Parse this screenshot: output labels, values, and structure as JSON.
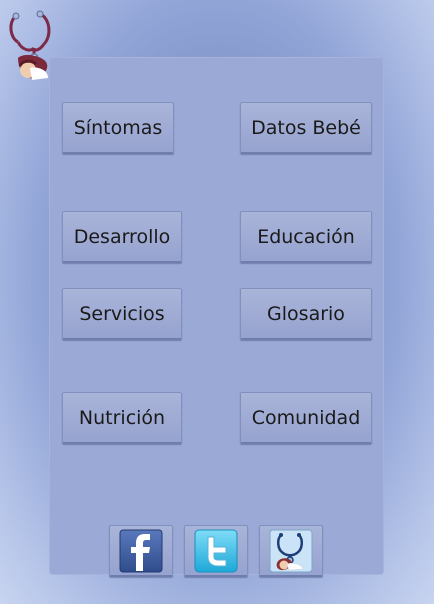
{
  "menu": {
    "sintomas": "Síntomas",
    "datos_bebe": "Datos Bebé",
    "desarrollo": "Desarrollo",
    "educacion": "Educación",
    "servicios": "Servicios",
    "glosario": "Glosario",
    "nutricion": "Nutrición",
    "comunidad": "Comunidad"
  },
  "social": {
    "facebook_icon": "facebook-icon",
    "twitter_icon": "twitter-icon",
    "app_icon": "stethoscope-baby-icon"
  },
  "colors": {
    "background": "#8fa2d2",
    "panel": "#9aa9d6",
    "button": "#a0acd6",
    "facebook": "#3b5998",
    "twitter": "#33c3f0"
  }
}
